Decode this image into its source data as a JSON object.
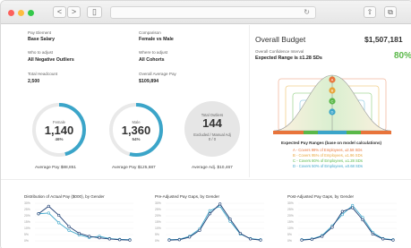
{
  "toolbar": {
    "back": "<",
    "forward": ">",
    "sidebar": "▯",
    "reload": "↻",
    "share": "⇧",
    "tabs": "⧉"
  },
  "filters": {
    "pay_element_label": "Pay Element",
    "pay_element_value": "Base Salary",
    "comparison_label": "Comparison",
    "comparison_value": "Female vs Male",
    "who_label": "Who to adjust",
    "who_value": "All Negative Outliers",
    "where_label": "Where to adjust",
    "where_value": "All Cohorts",
    "headcount_label": "Total Headcount",
    "headcount_value": "2,500",
    "avg_pay_label": "Overall Average Pay",
    "avg_pay_value": "$109,894"
  },
  "donuts": {
    "female": {
      "label": "Female",
      "count": "1,140",
      "pct": "46%",
      "fill": 0.46,
      "avg": "Average Pay $88,851"
    },
    "male": {
      "label": "Male",
      "count": "1,360",
      "pct": "54%",
      "fill": 0.54,
      "avg": "Average Pay $125,687"
    },
    "outliers": {
      "label": "Total Outliers",
      "count": "144",
      "sub": "Excluded / Manual Adj",
      "sub2": "0 / 0",
      "avg": "Average Adj. $10,467"
    }
  },
  "budget": {
    "title": "Overall Budget",
    "value": "$1,507,181",
    "conf_label": "Overall Confidence Interval",
    "conf_value": "Expected Range is ±1.28 SDs",
    "pct": "80%",
    "bands": [
      "A",
      "B",
      "C",
      "D"
    ],
    "legend_title": "Expected Pay Ranges (base on model calculations)",
    "legend": [
      {
        "text": "A - Covers 99% of Employees, ±2.58 SDs",
        "color": "#e8743b"
      },
      {
        "text": "B - Covers 95% of Employees, ±1.96 SDs",
        "color": "#e8a53b"
      },
      {
        "text": "C - Covers 80% of Employees, ±1.28 SDs",
        "color": "#5ab849"
      },
      {
        "text": "D - Covers 50% of Employees, ±0.68 SDs",
        "color": "#3ba5c9"
      }
    ]
  },
  "charts": {
    "c1_title": "Distribution of Actual Pay ($000), by Gender",
    "c2_title": "Pre-Adjusted Pay Gaps, by Gender",
    "c3_title": "Post-Adjusted Pay Gaps, by Gender",
    "yticks": [
      "30%",
      "25%",
      "20%",
      "15%",
      "10%",
      "5%",
      "0%"
    ]
  },
  "colors": {
    "female": "#3ba5c9",
    "male": "#1f3f73",
    "accent": "#5ab849"
  }
}
